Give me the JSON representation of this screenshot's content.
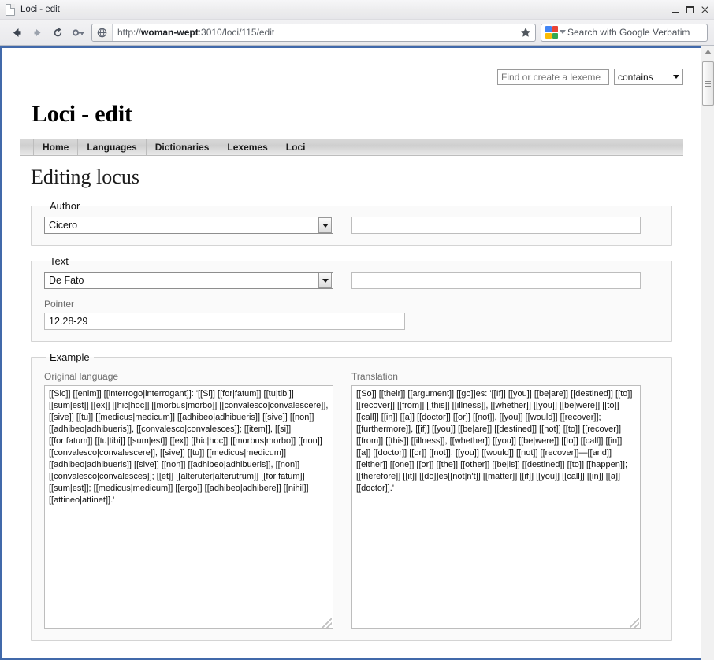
{
  "browser": {
    "window_title": "Loci - edit",
    "doc_icon": "page-icon",
    "minimize_label": "Minimize",
    "maximize_label": "Maximize",
    "close_label": "Close",
    "back_icon": "back-arrow-icon",
    "forward_icon": "forward-arrow-icon",
    "reload_icon": "reload-icon",
    "key_icon": "key-icon",
    "globe_icon": "globe-icon",
    "star_icon": "star-icon",
    "url_prefix": "http://",
    "url_host": "woman-wept",
    "url_suffix": ":3010/loci/115/edit",
    "url_full": "http://woman-wept:3010/loci/115/edit",
    "search_placeholder": "Search with Google Verbatim",
    "search_engine_icon": "google-logo-icon",
    "scrollbar_up_icon": "scroll-up-arrow-icon"
  },
  "page": {
    "lexeme_search": {
      "input_value": "",
      "input_placeholder": "Find or create a lexeme",
      "match_mode": "contains"
    },
    "site_title": "Loci - edit",
    "nav": [
      {
        "label": "Home"
      },
      {
        "label": "Languages"
      },
      {
        "label": "Dictionaries"
      },
      {
        "label": "Lexemes"
      },
      {
        "label": "Loci"
      }
    ],
    "heading": "Editing locus",
    "author": {
      "legend": "Author",
      "select_value": "Cicero",
      "extra_value": ""
    },
    "text": {
      "legend": "Text",
      "select_value": "De Fato",
      "extra_value": "",
      "pointer_label": "Pointer",
      "pointer_value": "12.28-29"
    },
    "example": {
      "legend": "Example",
      "original_label": "Original language",
      "translation_label": "Translation",
      "original_value": "[[Sic]] [[enim]] [[interrogo|interrogant]]: '[[Si]] [[for|fatum]] [[tu|tibi]] [[sum|est]] [[ex]] [[hic|hoc]] [[morbus|morbo]] [[convalesco|convalescere]], [[sive]] [[tu]] [[medicus|medicum]] [[adhibeo|adhibueris]] [[sive]] [[non]] [[adhibeo|adhibueris]], [[convalesco|convalesces]]; [[item]], [[si]] [[for|fatum]] [[tu|tibi]] [[sum|est]] [[ex]] [[hic|hoc]] [[morbus|morbo]] [[non]] [[convalesco|convalescere]], [[sive]] [[tu]] [[medicus|medicum]] [[adhibeo|adhibueris]] [[sive]] [[non]] [[adhibeo|adhibueris]], [[non]] [[convalesco|convalesces]]; [[et]] [[alteruter|alterutrum]] [[for|fatum]] [[sum|est]]; [[medicus|medicum]] [[ergo]] [[adhibeo|adhibere]] [[nihil]] [[attineo|attinet]].'",
      "translation_value": "[[So]] [[their]] [[argument]] [[go]]es: '[[If]] [[you]] [[be|are]] [[destined]] [[to]] [[recover]] [[from]] [[this]] [[illness]], [[whether]] [[you]] [[be|were]] [[to]] [[call]] [[in]] [[a]] [[doctor]] [[or]] [[not]], [[you]] [[would]] [[recover]]; [[furthermore]], [[if]] [[you]] [[be|are]] [[destined]] [[not]] [[to]] [[recover]] [[from]] [[this]] [[illness]], [[whether]] [[you]] [[be|were]] [[to]] [[call]] [[in]] [[a]] [[doctor]] [[or]] [[not]], [[you]] [[would]] [[not]] [[recover]]—[[and]] [[either]] [[one]] [[or]] [[the]] [[other]] [[be|is]] [[destined]] [[to]] [[happen]]; [[therefore]] [[it]] [[do]]es[[not|n't]] [[matter]] [[if]] [[you]] [[call]] [[in]] [[a]] [[doctor]].'"
    }
  },
  "colors": {
    "viewport_border": "#4169aa",
    "fieldset_bg": "#fafafa",
    "navtab_bg": "#d8d8d8"
  }
}
